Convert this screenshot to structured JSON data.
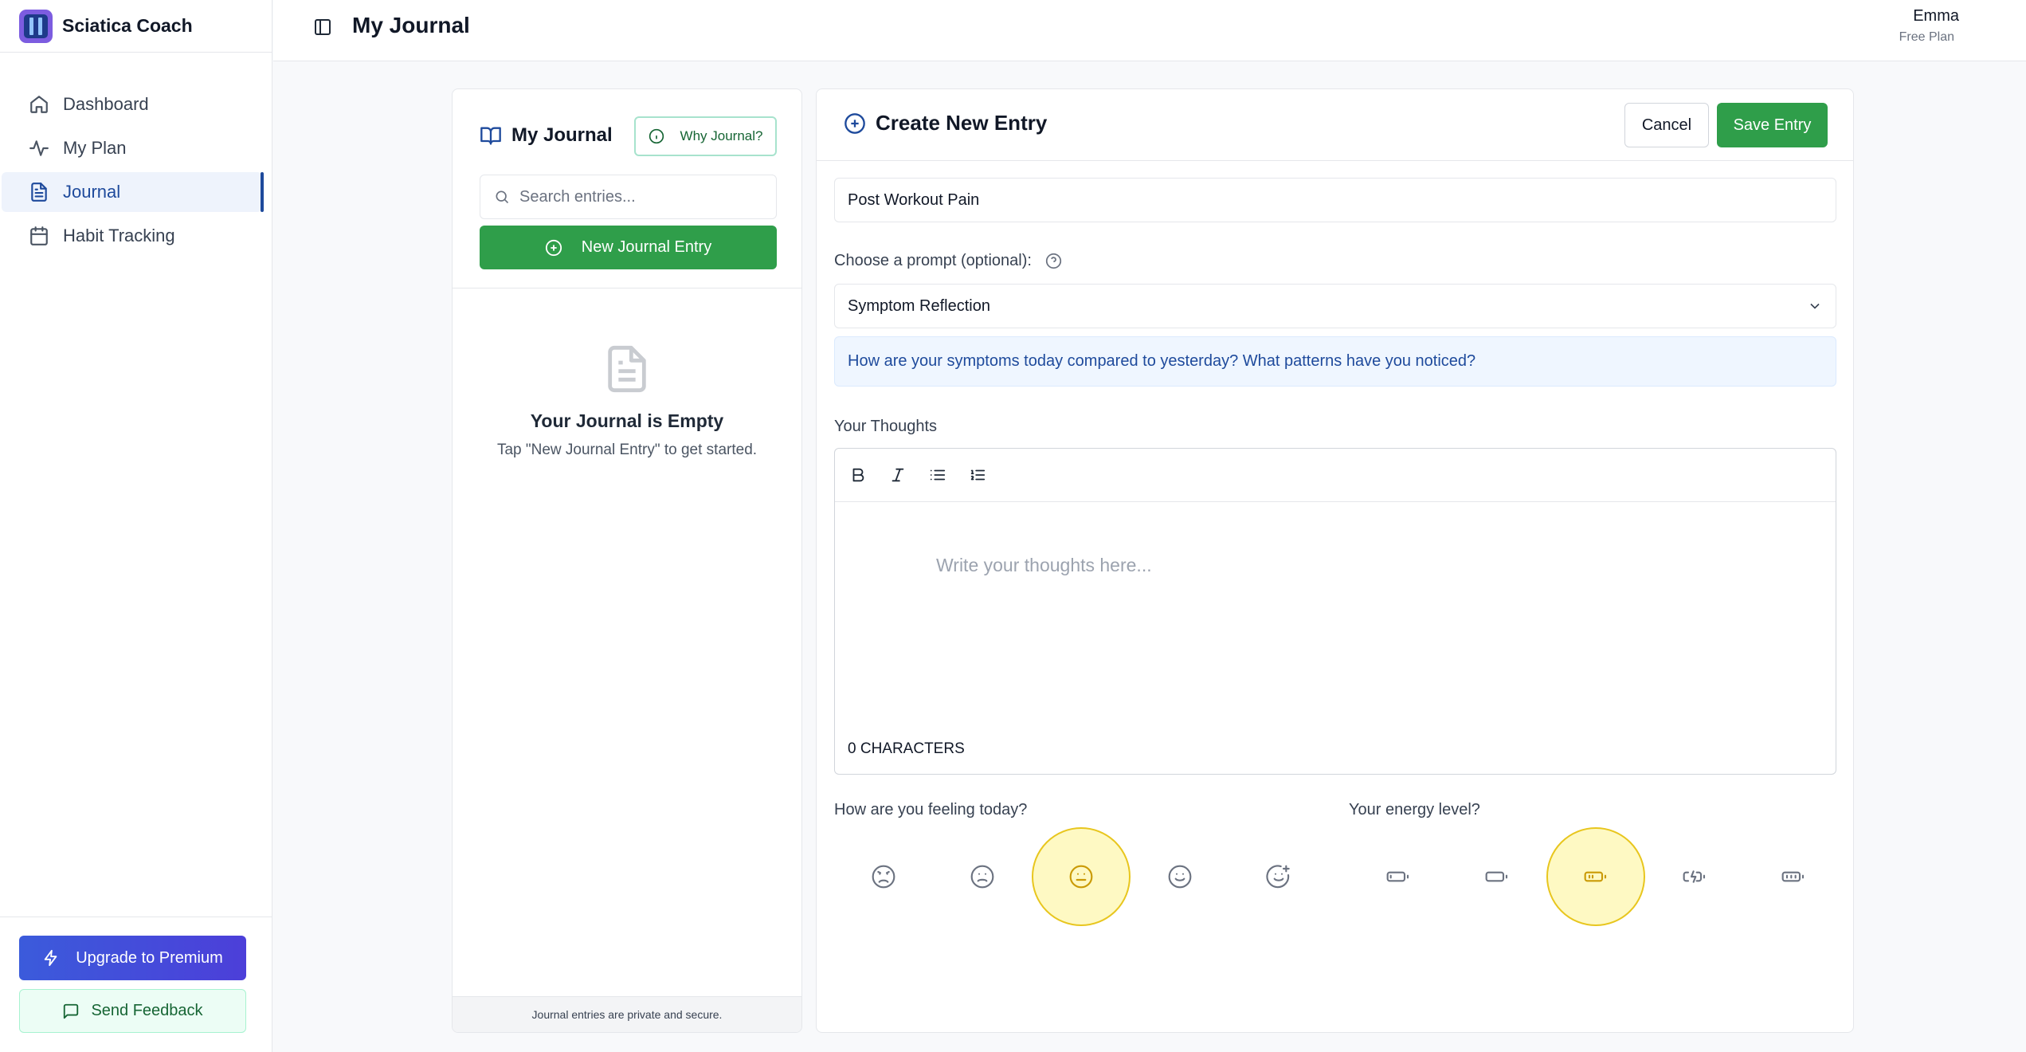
{
  "app": {
    "name": "Sciatica Coach"
  },
  "sidebar": {
    "items": [
      {
        "label": "Dashboard",
        "icon": "home-icon"
      },
      {
        "label": "My Plan",
        "icon": "activity-icon"
      },
      {
        "label": "Journal",
        "icon": "file-text-icon",
        "active": true
      },
      {
        "label": "Habit Tracking",
        "icon": "calendar-icon"
      }
    ],
    "upgrade_label": "Upgrade to Premium",
    "feedback_label": "Send Feedback"
  },
  "header": {
    "title": "My Journal",
    "user_name": "Emma",
    "user_plan": "Free Plan"
  },
  "journal_list": {
    "title": "My Journal",
    "why_label": "Why Journal?",
    "search_placeholder": "Search entries...",
    "new_entry_label": "New Journal Entry",
    "empty_title": "Your Journal is Empty",
    "empty_subtitle": "Tap \"New Journal Entry\" to get started.",
    "footer_note": "Journal entries are private and secure."
  },
  "entry_form": {
    "title": "Create New Entry",
    "cancel_label": "Cancel",
    "save_label": "Save Entry",
    "entry_title_value": "Post Workout Pain",
    "prompt_label": "Choose a prompt (optional):",
    "prompt_selected": "Symptom Reflection",
    "prompt_text": "How are your symptoms today compared to yesterday? What patterns have you noticed?",
    "thoughts_label": "Your Thoughts",
    "thoughts_placeholder": "Write your thoughts here...",
    "char_count": "0 CHARACTERS",
    "mood_label": "How are you feeling today?",
    "mood_selected": 3,
    "energy_label": "Your energy level?",
    "energy_selected": 3
  },
  "colors": {
    "primary_green": "#2f9e4a",
    "accent_blue": "#1e4a9c",
    "selected_yellow": "#e8c61e"
  }
}
